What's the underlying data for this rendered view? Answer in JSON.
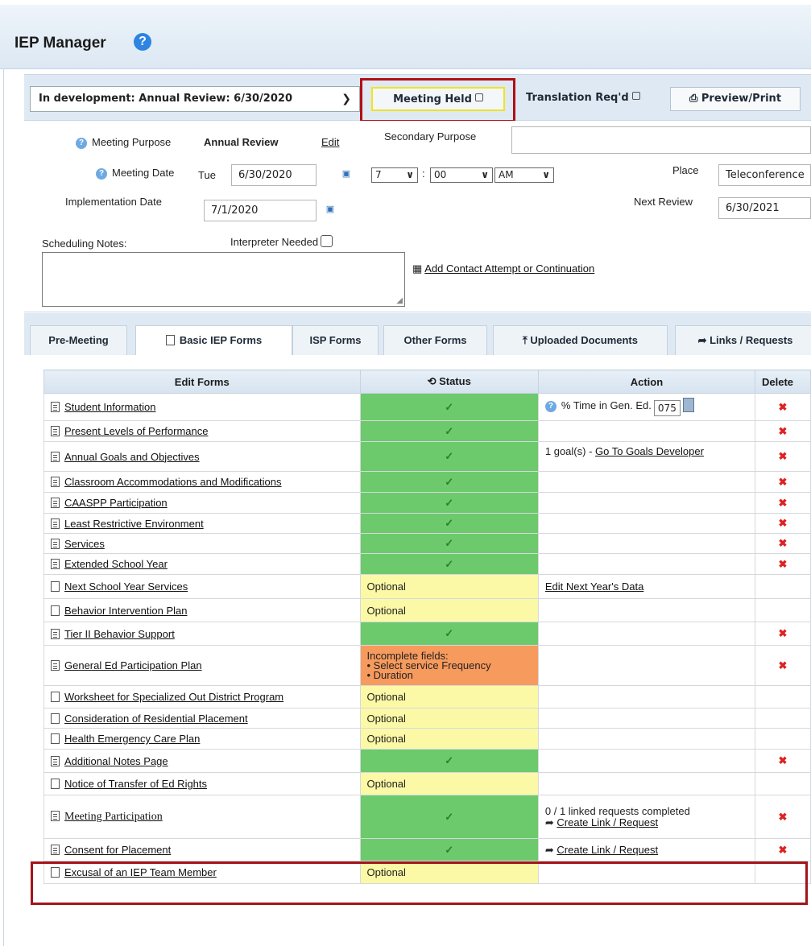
{
  "header": {
    "title": "IEP Manager",
    "help_icon": "?"
  },
  "toolbar": {
    "iep_select": "In development: Annual Review: 6/30/2020",
    "meeting_held": "Meeting Held",
    "translation": "Translation Req'd",
    "preview": "Preview/Print"
  },
  "meeting": {
    "purpose_label": "Meeting Purpose",
    "purpose_value": "Annual Review",
    "edit_link": "Edit",
    "secondary_label": "Secondary Purpose",
    "secondary_value": "",
    "date_label": "Meeting Date",
    "date_day": "Tue",
    "date_value": "6/30/2020",
    "hour": "7",
    "minute": "00",
    "ampm": "AM",
    "time_sep": ":",
    "place_label": "Place",
    "place_value": "Teleconference",
    "impl_label": "Implementation Date",
    "impl_value": "7/1/2020",
    "next_review_label": "Next Review",
    "next_review_value": "6/30/2021",
    "notes_label": "Scheduling Notes:",
    "interpreter_label": "Interpreter Needed",
    "contact_link": "Add Contact Attempt or Continuation"
  },
  "tabs": [
    {
      "label": "Pre-Meeting"
    },
    {
      "label": "Basic IEP Forms"
    },
    {
      "label": "ISP Forms"
    },
    {
      "label": "Other Forms"
    },
    {
      "label": "Uploaded Documents"
    },
    {
      "label": "Links / Requests"
    }
  ],
  "table": {
    "headers": {
      "form": "Edit Forms",
      "status": "Status",
      "action": "Action",
      "delete": "Delete"
    },
    "time_label": "% Time in Gen. Ed.",
    "time_value": "075",
    "rows": [
      {
        "name": "Student Information",
        "status": "✓"
      },
      {
        "name": "Present Levels of Performance",
        "status": "✓"
      },
      {
        "name": "Annual Goals and Objectives",
        "status": "✓",
        "action_text": "1 goal(s) - ",
        "action_link": "Go To Goals Developer"
      },
      {
        "name": "Classroom Accommodations and Modifications",
        "status": "✓"
      },
      {
        "name": "CAASPP Participation",
        "status": "✓"
      },
      {
        "name": "Least Restrictive Environment",
        "status": "✓"
      },
      {
        "name": "Services",
        "status": "✓"
      },
      {
        "name": "Extended School Year",
        "status": "✓"
      },
      {
        "name": "Next School Year Services",
        "status": "Optional",
        "action_link": "Edit Next Year's Data"
      },
      {
        "name": "Behavior Intervention Plan",
        "status": "Optional"
      },
      {
        "name": "Tier II Behavior Support",
        "status": "✓"
      },
      {
        "name": "General Ed Participation Plan",
        "status": "Incomplete fields:",
        "status_l2": "• Select service Frequency",
        "status_l3": "• Duration"
      },
      {
        "name": "Worksheet for Specialized Out District Program",
        "status": "Optional"
      },
      {
        "name": "Consideration of Residential Placement",
        "status": "Optional"
      },
      {
        "name": "Health Emergency Care Plan",
        "status": "Optional"
      },
      {
        "name": "Additional Notes Page",
        "status": "✓"
      },
      {
        "name": "Notice of Transfer of Ed Rights",
        "status": "Optional"
      },
      {
        "name": "Meeting Participation",
        "status": "✓",
        "action_text": "0 / 1 linked requests completed",
        "action_link": "Create Link / Request"
      },
      {
        "name": "Consent for Placement",
        "status": "✓",
        "action_link": "Create Link / Request"
      },
      {
        "name": "Excusal of an IEP Team Member",
        "status": "Optional"
      }
    ],
    "delete_mark": "✖"
  }
}
